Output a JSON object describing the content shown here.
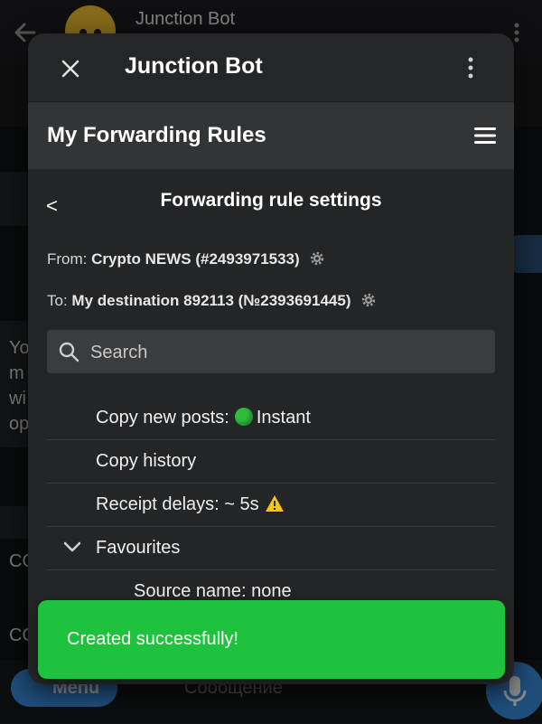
{
  "background": {
    "chat_title": "Junction Bot",
    "menu_label": "Menu",
    "input_placeholder": "Сообщение",
    "text_fragments": [
      "Yo",
      "m",
      "wi",
      "op",
      "CO",
      "CO"
    ]
  },
  "modal": {
    "title": "Junction Bot",
    "section_title": "My Forwarding Rules",
    "back_label": "<",
    "page_heading": "Forwarding rule settings",
    "from_prefix": "From:",
    "from_value": "Crypto NEWS (#2493971533)",
    "to_prefix": "To:",
    "to_value": "My destination 892113 (№2393691445)",
    "search": {
      "placeholder": "Search",
      "value": ""
    },
    "rows": [
      {
        "label": "Copy new posts:",
        "status": "Instant"
      },
      {
        "label": "Copy history"
      },
      {
        "label": "Receipt delays: ~ 5s"
      },
      {
        "label": "Favourites"
      },
      {
        "label": "Source name: none"
      }
    ]
  },
  "toast": {
    "message": "Created successfully!"
  },
  "colors": {
    "accent_blue": "#3a8fe0",
    "toast_green": "#1fc23d",
    "status_green": "#2ebd3b",
    "warning_yellow": "#f5c518"
  }
}
